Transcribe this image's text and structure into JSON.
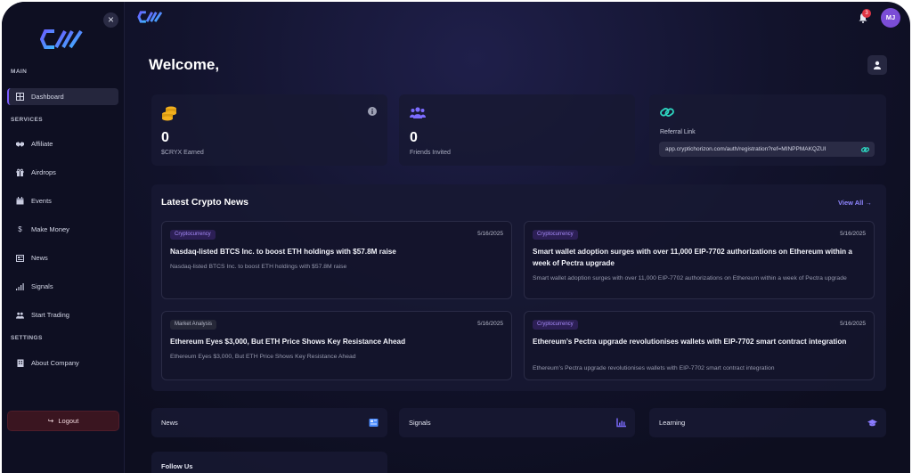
{
  "sidebar": {
    "sections": {
      "main": "MAIN",
      "services": "SERVICES",
      "settings": "SETTINGS"
    },
    "items": [
      {
        "label": "Dashboard",
        "icon": "grid-icon"
      },
      {
        "label": "Affiliate",
        "icon": "handshake-icon"
      },
      {
        "label": "Airdrops",
        "icon": "gift-icon"
      },
      {
        "label": "Events",
        "icon": "calendar-icon"
      },
      {
        "label": "Make Money",
        "icon": "dollar-icon"
      },
      {
        "label": "News",
        "icon": "newspaper-icon"
      },
      {
        "label": "Signals",
        "icon": "signal-bars-icon"
      },
      {
        "label": "Start Trading",
        "icon": "users-icon"
      },
      {
        "label": "About Company",
        "icon": "building-icon"
      }
    ],
    "logout_label": "Logout",
    "close_label": "×"
  },
  "header": {
    "notification_count": "3",
    "avatar_initials": "MJ",
    "welcome": "Welcome,"
  },
  "stats": {
    "earned": {
      "value": "0",
      "label": "$CRYX Earned"
    },
    "friends": {
      "value": "0",
      "label": "Friends Invited"
    }
  },
  "referral": {
    "label": "Referral Link",
    "link": "app.cryptichorizon.com/auth/registration?ref=MINPPMAKQZUI"
  },
  "news": {
    "title": "Latest Crypto News",
    "view_all": "View All →",
    "items": [
      {
        "tag": "Cryptocurrency",
        "date": "5/16/2025",
        "title": "Nasdaq-listed BTCS Inc. to boost ETH holdings with $57.8M raise",
        "desc": "Nasdaq-listed BTCS Inc. to boost ETH holdings with $57.8M raise"
      },
      {
        "tag": "Cryptocurrency",
        "date": "5/16/2025",
        "title": "Smart wallet adoption surges with over 11,000 EIP-7702 authorizations on Ethereum within a week of Pectra upgrade",
        "desc": "Smart wallet adoption surges with over 11,000 EIP-7702 authorizations on Ethereum within a week of Pectra upgrade"
      },
      {
        "tag": "Market Analysis",
        "date": "5/16/2025",
        "title": "Ethereum Eyes $3,000, But ETH Price Shows Key Resistance Ahead",
        "desc": "Ethereum Eyes $3,000, But ETH Price Shows Key Resistance Ahead"
      },
      {
        "tag": "Cryptocurrency",
        "date": "5/16/2025",
        "title": "Ethereum’s Pectra upgrade revolutionises wallets with EIP-7702 smart contract integration",
        "desc": "Ethereum’s Pectra upgrade revolutionises wallets with EIP-7702 smart contract integration"
      }
    ]
  },
  "quick_links": [
    {
      "label": "News",
      "icon": "newspaper-icon"
    },
    {
      "label": "Signals",
      "icon": "chart-icon"
    },
    {
      "label": "Learning",
      "icon": "graduation-cap-icon"
    }
  ],
  "follow_us": "Follow Us",
  "colors": {
    "accent": "#7c5cff",
    "gold": "#f2b01e",
    "teal": "#2dd4bf",
    "danger": "#e03545"
  }
}
